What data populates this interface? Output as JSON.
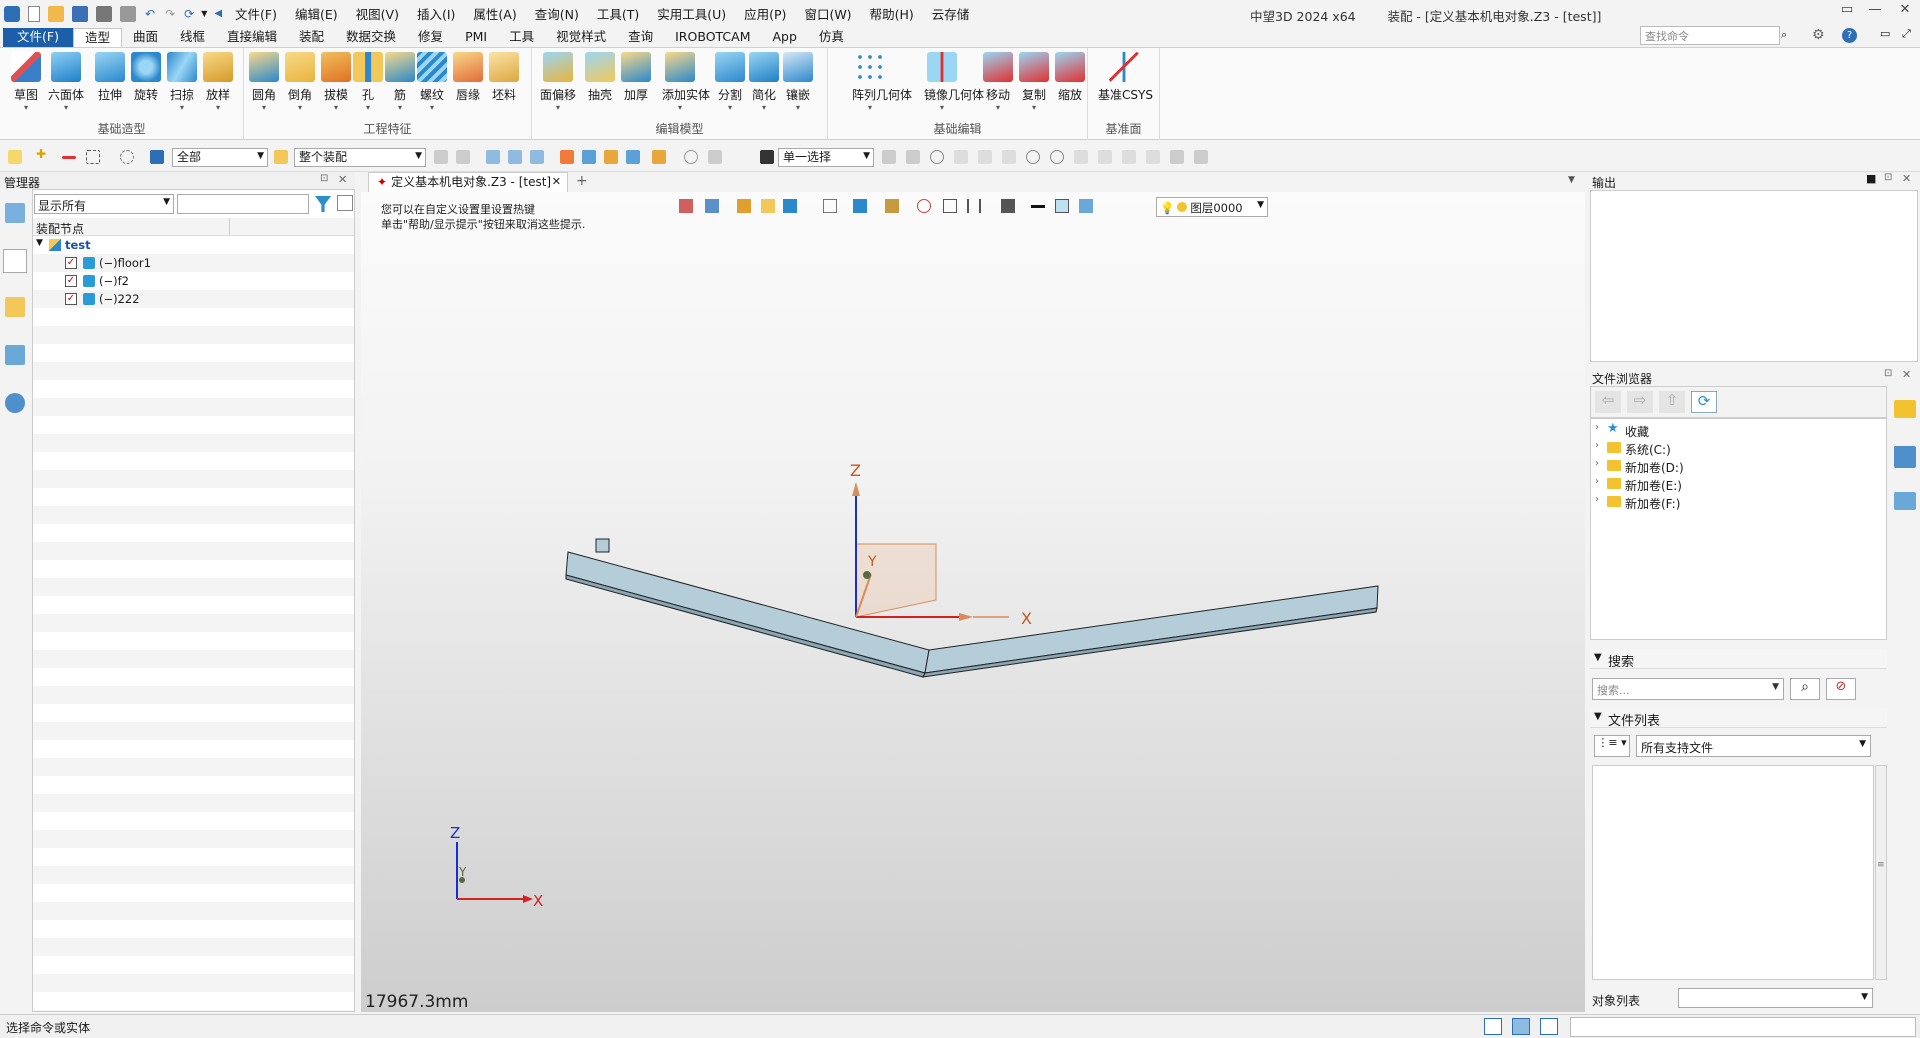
{
  "titlebar": {
    "menus": [
      "文件(F)",
      "编辑(E)",
      "视图(V)",
      "插入(I)",
      "属性(A)",
      "查询(N)",
      "工具(T)",
      "实用工具(U)",
      "应用(P)",
      "窗口(W)",
      "帮助(H)",
      "云存储"
    ],
    "app_name": "中望3D 2024 x64",
    "doc_title": "装配 - [定义基本机电对象.Z3 - [test]]"
  },
  "tabs": [
    "文件(F)",
    "造型",
    "曲面",
    "线框",
    "直接编辑",
    "装配",
    "数据交换",
    "修复",
    "PMI",
    "工具",
    "视觉样式",
    "查询",
    "IROBOTCAM",
    "App",
    "仿真"
  ],
  "active_tab": "造型",
  "command_search": {
    "placeholder": "查找命令"
  },
  "ribbon": {
    "groups": [
      {
        "label": "基础造型",
        "buttons": [
          "草图",
          "六面体",
          "拉伸",
          "旋转",
          "扫掠",
          "放样"
        ]
      },
      {
        "label": "工程特征",
        "buttons": [
          "圆角",
          "倒角",
          "拔模",
          "孔",
          "筋",
          "螺纹",
          "唇缘",
          "坯料"
        ]
      },
      {
        "label": "编辑模型",
        "buttons": [
          "面偏移",
          "抽壳",
          "加厚",
          "添加实体",
          "分割",
          "简化",
          "镶嵌"
        ]
      },
      {
        "label": "基础编辑",
        "buttons": [
          "阵列几何体",
          "镜像几何体",
          "移动",
          "复制",
          "缩放"
        ]
      },
      {
        "label": "基准面",
        "buttons": [
          "基准CSYS"
        ]
      }
    ]
  },
  "toolbar": {
    "filter_value": "全部",
    "scope_value": "整个装配",
    "select_mode": "单一选择"
  },
  "manager": {
    "title": "管理器",
    "filter_value": "显示所有",
    "column_header": "装配节点",
    "root": "test",
    "children": [
      "(−)floor1",
      "(−)f2",
      "(−)222"
    ]
  },
  "document": {
    "tab_label": "定义基本机电对象.Z3 - [test]",
    "hint_line1": "您可以在自定义设置里设置热键",
    "hint_line2": "单击\"帮助/显示提示\"按钮来取消这些提示.",
    "layer": "图层0000",
    "scale": "17967.3mm",
    "axis_x": "X",
    "axis_y": "Y",
    "axis_z": "Z"
  },
  "output": {
    "title": "输出"
  },
  "file_browser": {
    "title": "文件浏览器",
    "items": [
      "收藏",
      "系统(C:)",
      "新加卷(D:)",
      "新加卷(E:)",
      "新加卷(F:)"
    ]
  },
  "search": {
    "title": "搜索",
    "placeholder": "搜索..."
  },
  "file_list": {
    "title": "文件列表",
    "filter": "所有支持文件"
  },
  "object_list": {
    "label": "对象列表"
  },
  "status": {
    "text": "选择命令或实体"
  },
  "colors": {
    "accent": "#1c5ea8",
    "part_face": "#a9c4d2",
    "axis_x": "#d42020",
    "axis_z": "#1a2fc8",
    "axis_label": "#c8581a"
  }
}
